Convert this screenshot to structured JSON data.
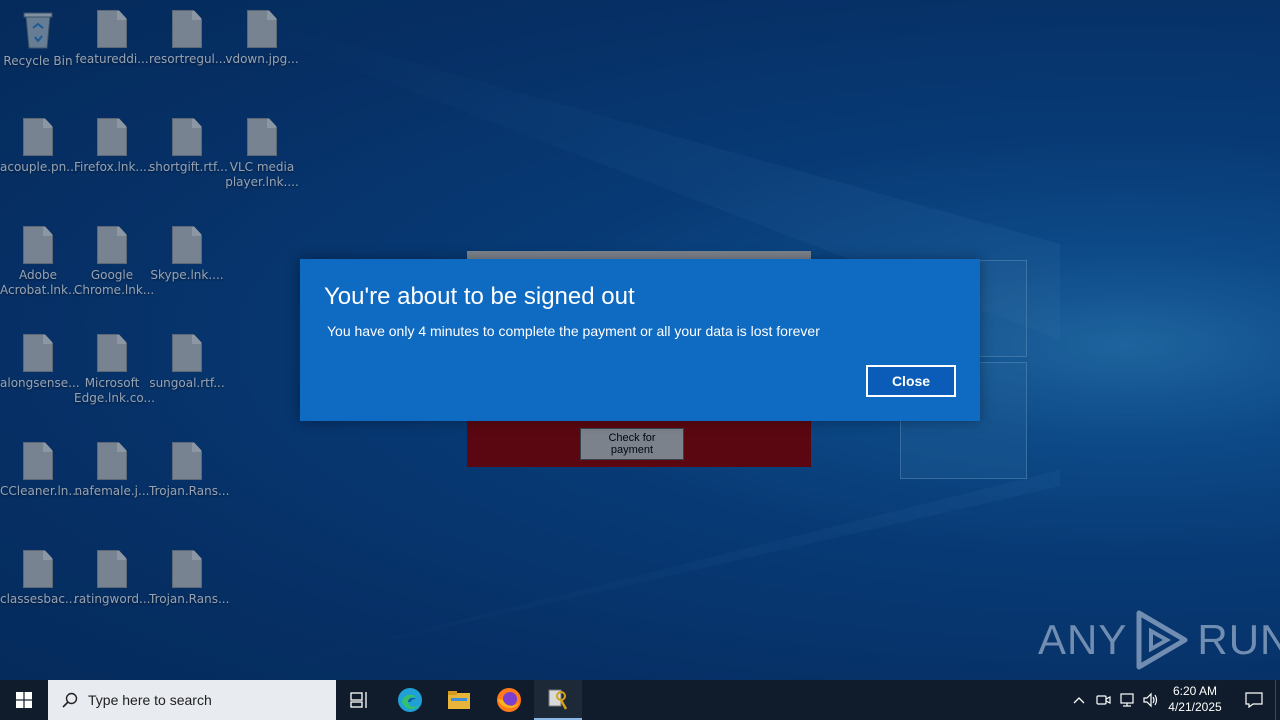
{
  "desktop": {
    "icons": [
      {
        "label": "Recycle Bin",
        "type": "bin"
      },
      {
        "label": "featureddi...",
        "type": "file"
      },
      {
        "label": "resortregul...",
        "type": "file"
      },
      {
        "label": "vdown.jpg...",
        "type": "file"
      },
      {
        "label": "acouple.pn...",
        "type": "file"
      },
      {
        "label": "Firefox.lnk....",
        "type": "file"
      },
      {
        "label": "shortgift.rtf...",
        "type": "file"
      },
      {
        "label": "VLC media player.lnk....",
        "type": "file"
      },
      {
        "label": "Adobe Acrobat.lnk...",
        "type": "file"
      },
      {
        "label": "Google Chrome.lnk...",
        "type": "file"
      },
      {
        "label": "Skype.lnk....",
        "type": "file"
      },
      {
        "label": "alongsense...",
        "type": "file"
      },
      {
        "label": "Microsoft Edge.lnk.co...",
        "type": "file"
      },
      {
        "label": "sungoal.rtf...",
        "type": "file"
      },
      {
        "label": "CCleaner.ln...",
        "type": "file"
      },
      {
        "label": "nafemale.j...",
        "type": "file"
      },
      {
        "label": "Trojan.Rans...",
        "type": "file"
      },
      {
        "label": "classesbac...",
        "type": "file"
      },
      {
        "label": "ratingword....",
        "type": "file"
      },
      {
        "label": "Trojan.Rans...",
        "type": "file"
      }
    ]
  },
  "app_window": {
    "check_button_label": "Check for payment",
    "background_color": "#8b0000"
  },
  "dialog": {
    "title": "You're about to be signed out",
    "message": "You have only 4 minutes to complete the payment or all your data is lost forever",
    "close_label": "Close",
    "background_color": "#0f6ac2"
  },
  "watermark": {
    "left_text": "ANY",
    "right_text": "RUN"
  },
  "taskbar": {
    "search_placeholder": "Type here to search",
    "pinned": [
      "task-view-icon",
      "edge-icon",
      "file-explorer-icon",
      "firefox-icon",
      "ransomware-app-icon"
    ],
    "tray_icons": [
      "chevron-up-icon",
      "meet-now-icon",
      "network-icon",
      "volume-icon"
    ],
    "time": "6:20 AM",
    "date": "4/21/2025"
  }
}
